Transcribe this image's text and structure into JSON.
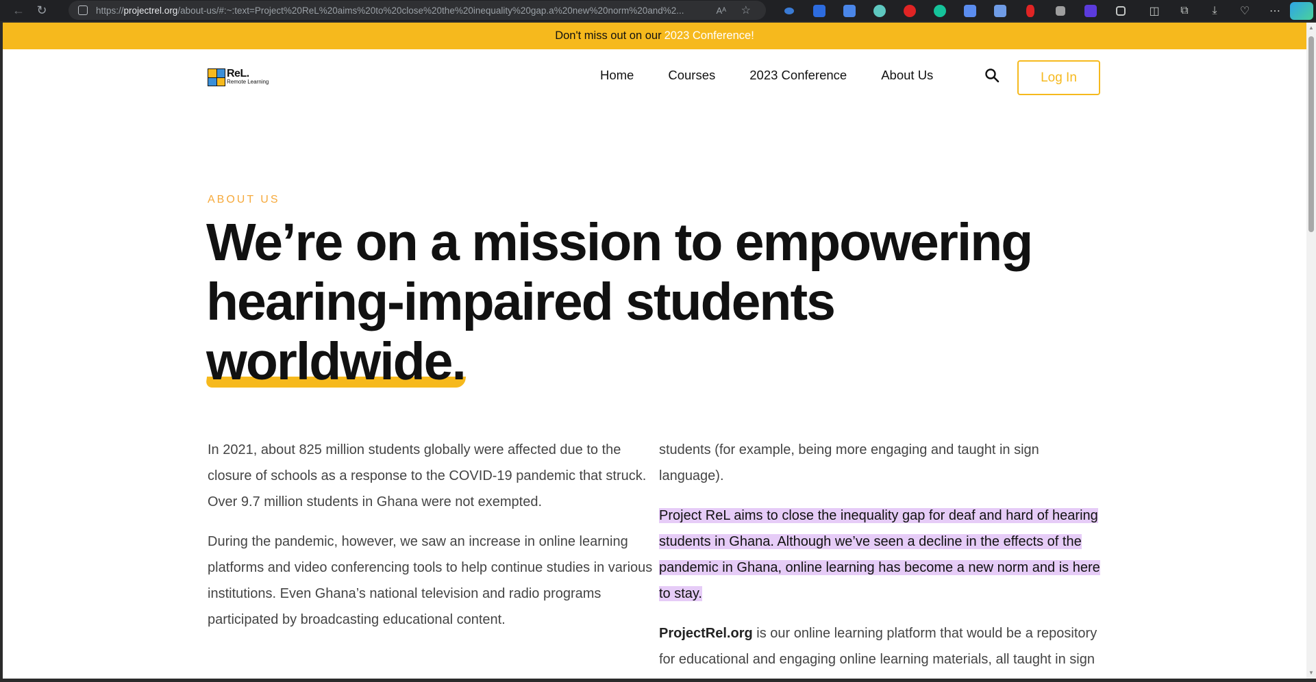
{
  "browser": {
    "url_host": "projectrel.org",
    "url_rest": "/about-us/#:~:text=Project%20ReL%20aims%20to%20close%20the%20inequality%20gap.a%20new%20norm%20and%2...",
    "url_scheme": "https://",
    "read_aloud": "Aᴬ"
  },
  "banner": {
    "text": "Don't miss out on our",
    "link": "2023 Conference!"
  },
  "logo": {
    "title": "ReL.",
    "subtitle": "Remote Learning"
  },
  "nav": {
    "items": [
      {
        "label": "Home"
      },
      {
        "label": "Courses"
      },
      {
        "label": "2023 Conference"
      },
      {
        "label": "About Us"
      }
    ],
    "login_label": "Log In"
  },
  "hero": {
    "eyebrow": "ABOUT US",
    "line1": "We’re on a mission to empowering",
    "line2": "hearing-impaired students",
    "line3": "worldwide."
  },
  "content": {
    "left_p1": "In 2021, about 825 million students globally were affected due to the closure of schools as a response to the COVID-19 pandemic that struck. Over 9.7 million students in Ghana were not exempted.",
    "left_p2": "During the pandemic, however, we saw an increase in online learning platforms and video conferencing tools to help continue studies in various institutions. Even Ghana’s national television and radio programs participated by broadcasting educational content.",
    "right_p1": "students (for example, being more engaging and taught in sign language).",
    "right_p2_highlight": "Project ReL aims to close the inequality gap for deaf and hard of hearing students in Ghana. Although we’ve seen a decline in the effects of the pandemic in Ghana, online learning has become a new norm and is here to stay.",
    "right_p3_strong": "ProjectRel.org",
    "right_p3_rest": " is our online learning platform that would be a repository for educational and engaging online learning materials, all taught in sign language. The content are tailored"
  },
  "colors": {
    "accent": "#f6b91d",
    "eyebrow": "#f6a93b",
    "highlight": "#e6ccf7"
  }
}
